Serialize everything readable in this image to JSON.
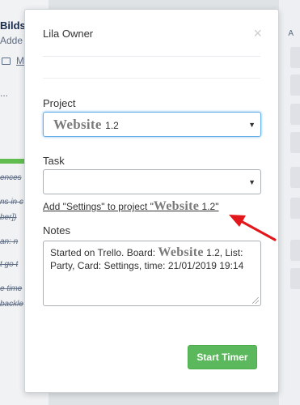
{
  "background": {
    "card_title": "Bilds",
    "added_text": "Adde",
    "row_text": "M",
    "link_text": "...",
    "checklist_items": [
      "ences",
      "ns in c",
      "ber])",
      "an: n",
      "t go t",
      "e time",
      "backle"
    ],
    "right_label": "A"
  },
  "modal": {
    "user_name": "Lila Owner",
    "close_glyph": "×",
    "project": {
      "label": "Project",
      "selected_name": "Website",
      "selected_version": "1.2",
      "caret": "▼"
    },
    "task": {
      "label": "Task",
      "selected": "",
      "caret": "▼"
    },
    "suggestion": {
      "prefix": "Add \"Settings\" to project \"",
      "project_name": "Website",
      "suffix": " 1.2\""
    },
    "notes": {
      "label": "Notes",
      "part1": "Started on Trello. Board: ",
      "project_name": "Website",
      "part2": " 1.2, List: Party, Card: Settings, time: 21/01/2019 19:14"
    },
    "start_button": "Start Timer"
  },
  "colors": {
    "accent_green": "#5cb85c",
    "focus_blue": "#66afe9",
    "annotation_arrow": "#e3161b"
  }
}
